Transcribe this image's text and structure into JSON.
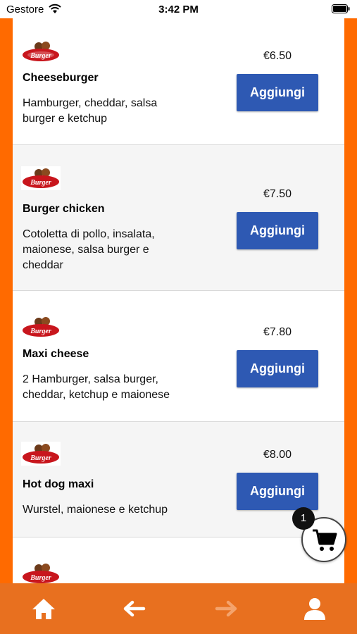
{
  "status_bar": {
    "carrier": "Gestore",
    "time": "3:42 PM"
  },
  "products": [
    {
      "name": "Cheeseburger",
      "description": "Hamburger, cheddar, salsa burger e ketchup",
      "price": "€6.50",
      "button_label": "Aggiungi"
    },
    {
      "name": "Burger chicken",
      "description": "Cotoletta di pollo, insalata, maionese, salsa burger e cheddar",
      "price": "€7.50",
      "button_label": "Aggiungi"
    },
    {
      "name": "Maxi cheese",
      "description": "2 Hamburger, salsa burger, cheddar, ketchup e maionese",
      "price": "€7.80",
      "button_label": "Aggiungi"
    },
    {
      "name": "Hot dog maxi",
      "description": "Wurstel, maionese e ketchup",
      "price": "€8.00",
      "button_label": "Aggiungi"
    }
  ],
  "logo": {
    "brand_text": "Burger"
  },
  "cart": {
    "count": "1",
    "icon": "cart-icon"
  },
  "bottom_nav": [
    {
      "icon": "home-icon"
    },
    {
      "icon": "arrow-left-icon"
    },
    {
      "icon": "arrow-right-icon",
      "disabled": true
    },
    {
      "icon": "user-icon"
    }
  ],
  "colors": {
    "accent_orange": "#ff6a00",
    "nav_orange": "#e8701f",
    "button_blue": "#2e59b3"
  }
}
